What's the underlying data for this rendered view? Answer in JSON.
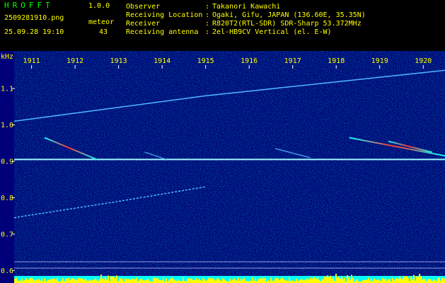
{
  "app": {
    "name": "HROFFT",
    "version": "1.0.0"
  },
  "file": {
    "name": "2509281910.png",
    "datetime": "25.09.28 19:10"
  },
  "meteor": {
    "label": "meteor",
    "count": "43"
  },
  "info": [
    {
      "label": "Observer",
      "value": "Takanori Kawachi"
    },
    {
      "label": "Receiving Location",
      "value": "Ogaki, Gifu, JAPAN (136.60E, 35.35N)"
    },
    {
      "label": "Receiver",
      "value": "R820T2(RTL-SDR) SDR-Sharp 53.372MHz"
    },
    {
      "label": "Receiving antenna",
      "value": "2el-HB9CV Vertical (el. E-W)"
    }
  ],
  "colon": ":",
  "colors": {
    "header_text": "#ffff00",
    "app_name": "#00ff00",
    "axis_text": "#ffff00",
    "background": "#00008b"
  },
  "chart_data": {
    "type": "heatmap",
    "ylabel": "kHz",
    "x_ticks": [
      "1911",
      "1912",
      "1913",
      "1914",
      "1915",
      "1916",
      "1917",
      "1918",
      "1919",
      "1920"
    ],
    "y_ticks": [
      {
        "label": "1.1",
        "value": 1.1
      },
      {
        "label": "1.0",
        "value": 1.0
      },
      {
        "label": "0.9",
        "value": 0.9
      },
      {
        "label": "0.8",
        "value": 0.8
      },
      {
        "label": "0.7",
        "value": 0.7
      },
      {
        "label": "0.6",
        "value": 0.6
      }
    ],
    "xlim": [
      1910.6,
      1920.5
    ],
    "ylim": [
      0.585,
      1.18
    ],
    "traces": [
      {
        "name": "rising carrier",
        "points": [
          [
            1910.6,
            1.01
          ],
          [
            1915.0,
            1.08
          ],
          [
            1920.5,
            1.15
          ]
        ]
      },
      {
        "name": "steady carrier",
        "points": [
          [
            1910.6,
            0.905
          ],
          [
            1920.5,
            0.905
          ]
        ]
      },
      {
        "name": "lower drift",
        "points": [
          [
            1910.6,
            0.745
          ],
          [
            1913.0,
            0.79
          ],
          [
            1915.0,
            0.83
          ]
        ]
      },
      {
        "name": "meteor echo 1",
        "points": [
          [
            1911.3,
            0.965
          ],
          [
            1912.5,
            0.905
          ]
        ]
      },
      {
        "name": "meteor echo 2",
        "points": [
          [
            1918.3,
            0.965
          ],
          [
            1920.5,
            0.915
          ]
        ]
      },
      {
        "name": "meteor echo 3",
        "points": [
          [
            1919.2,
            0.955
          ],
          [
            1920.2,
            0.925
          ]
        ]
      },
      {
        "name": "fade 1",
        "points": [
          [
            1913.6,
            0.925
          ],
          [
            1914.1,
            0.905
          ]
        ]
      },
      {
        "name": "fade 2",
        "points": [
          [
            1916.6,
            0.935
          ],
          [
            1917.4,
            0.91
          ]
        ]
      }
    ],
    "grid": false
  }
}
